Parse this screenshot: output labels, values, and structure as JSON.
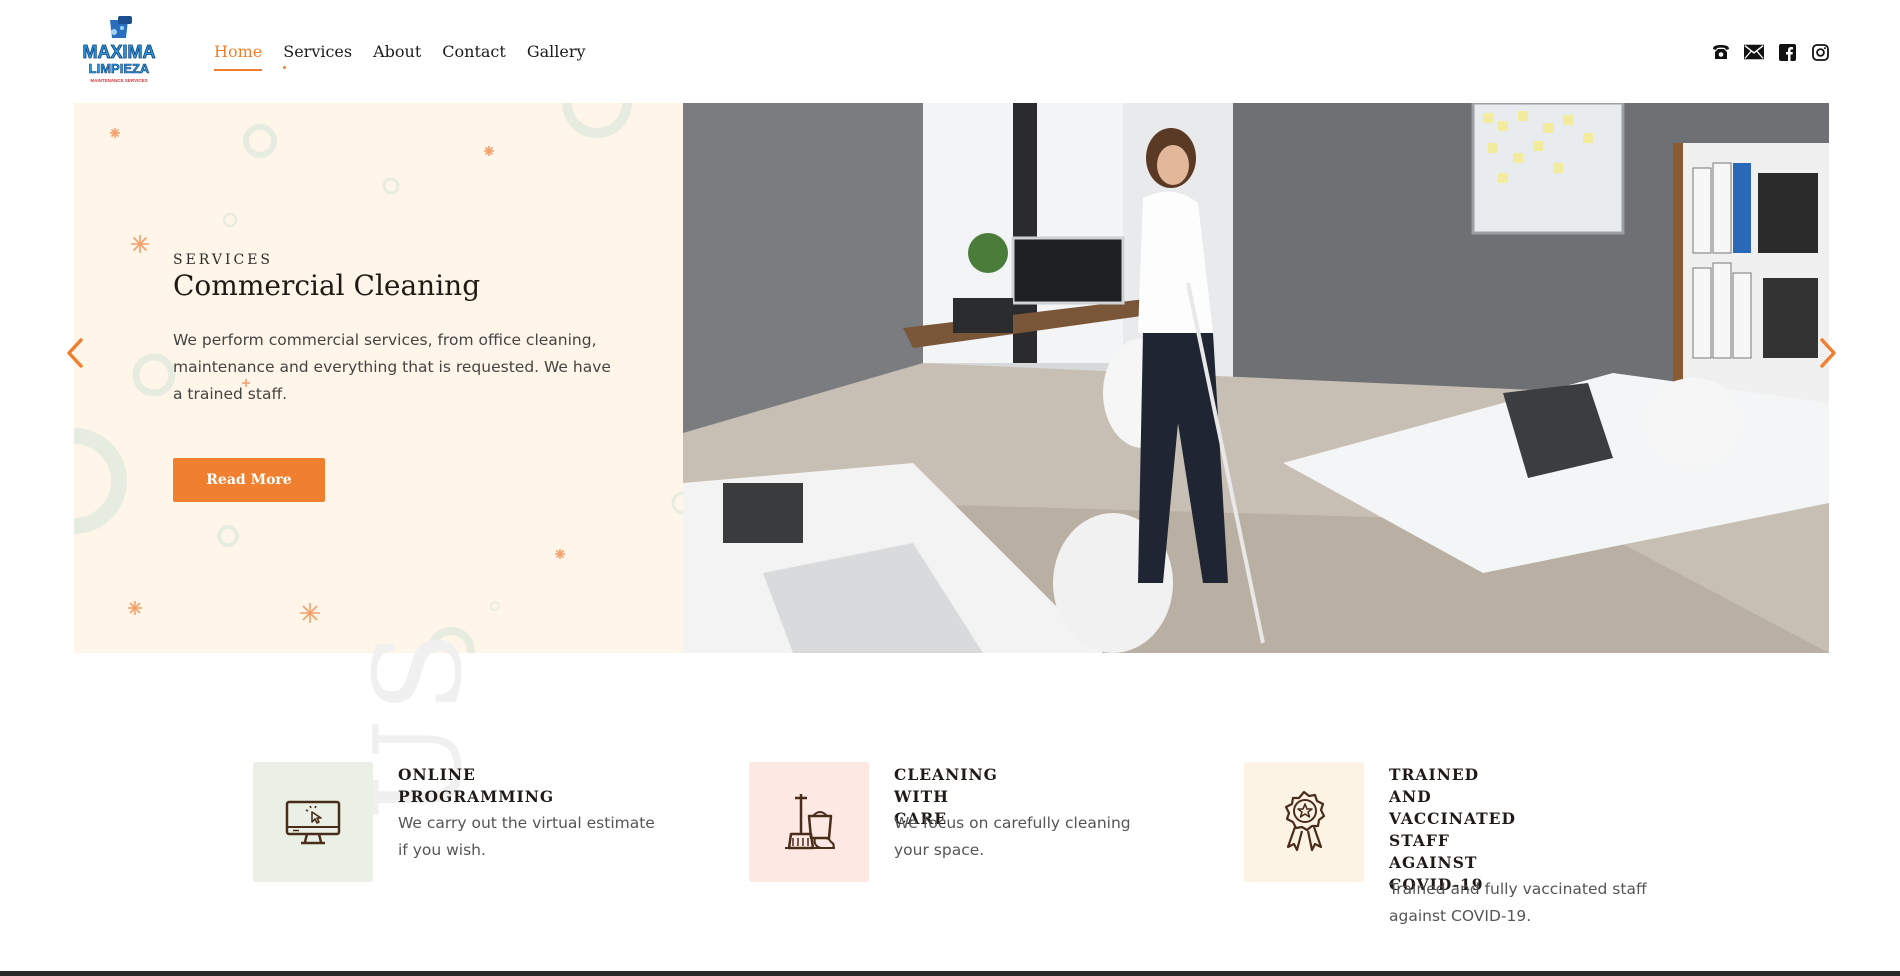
{
  "brand": {
    "logo_line1": "MAXIMA",
    "logo_line2": "LIMPIEZA",
    "logo_line3": "MAINTENANCE SERVICES",
    "accent": "#f0802f"
  },
  "nav": {
    "items": [
      {
        "label": "Home"
      },
      {
        "label": "Services"
      },
      {
        "label": "About"
      },
      {
        "label": "Contact"
      },
      {
        "label": "Gallery"
      }
    ]
  },
  "header_icons": [
    "phone-icon",
    "mail-icon",
    "facebook-icon",
    "instagram-icon"
  ],
  "hero": {
    "eyebrow": "SERVICES",
    "title": "Commercial Cleaning",
    "text": "We perform commercial services, from office cleaning, maintenance and everything that is requested. We have a trained staff.",
    "button": "Read More",
    "bg": "#fff5e8"
  },
  "features": [
    {
      "title": "ONLINE\nPROGRAMMING",
      "text": "We carry out the virtual estimate if you wish.",
      "icon": "monitor-click-icon",
      "bg": "#eaf0e6"
    },
    {
      "title": "CLEANING\nWITH CARE",
      "text": "We focus on carefully cleaning your space.",
      "icon": "mop-bucket-icon",
      "bg": "#fde8e3"
    },
    {
      "title": "TRAINED AND\nVACCINATED\nSTAFF\nAGAINST\nCOVID-19",
      "text": "Trained and fully vaccinated staff against COVID-19.",
      "icon": "award-badge-icon",
      "bg": "#fdf3e4"
    }
  ]
}
